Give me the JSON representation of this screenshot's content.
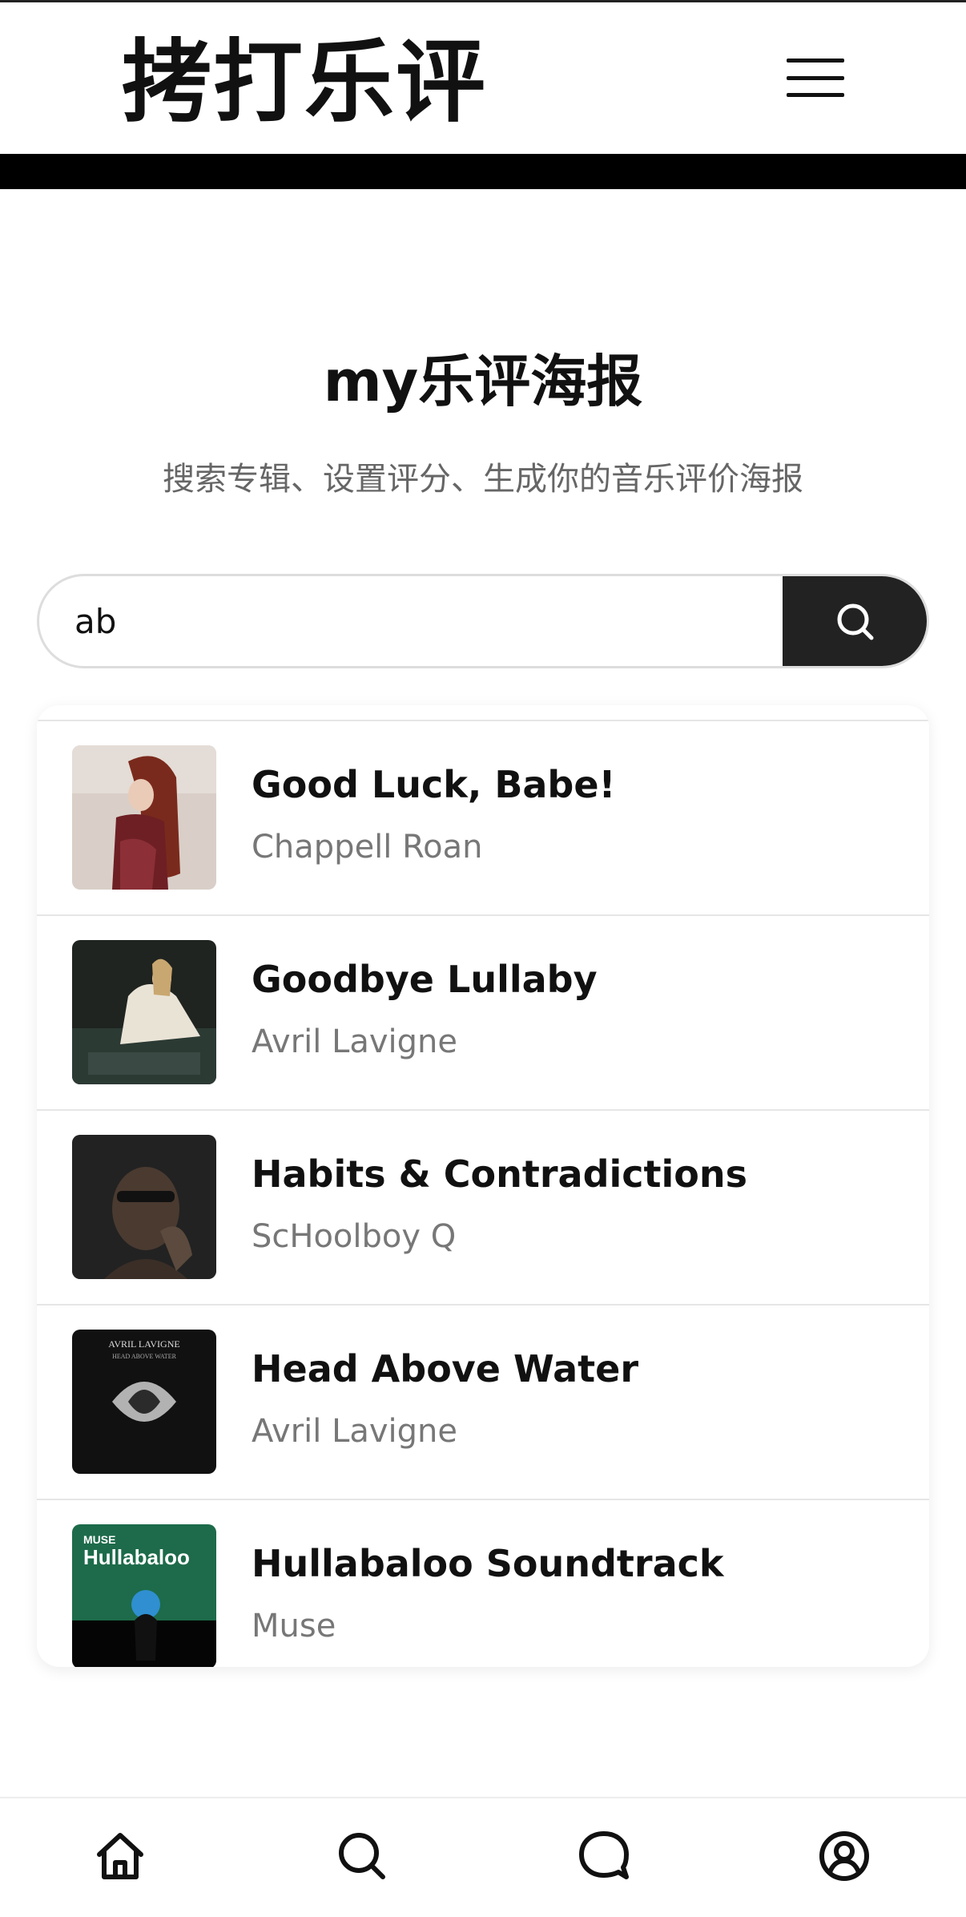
{
  "app": {
    "logo": "拷打乐评"
  },
  "main": {
    "title": "my乐评海报",
    "subtitle": "搜索专辑、设置评分、生成你的音乐评价海报"
  },
  "search": {
    "value": "ab",
    "icon": "search-icon"
  },
  "results": [
    {
      "album": "Good Luck, Babe!",
      "artist": "Chappell Roan"
    },
    {
      "album": "Goodbye Lullaby",
      "artist": "Avril Lavigne"
    },
    {
      "album": "Habits & Contradictions",
      "artist": "ScHoolboy Q"
    },
    {
      "album": "Head Above Water",
      "artist": "Avril Lavigne"
    },
    {
      "album": "Hullabaloo Soundtrack",
      "artist": "Muse"
    }
  ],
  "covers": {
    "c4": {
      "line1": "AVRIL LAVIGNE",
      "line2": "HEAD ABOVE WATER"
    },
    "c5": {
      "line1": "MUSE",
      "line2": "Hullabaloo"
    }
  },
  "nav": [
    {
      "icon": "home-icon"
    },
    {
      "icon": "search-icon"
    },
    {
      "icon": "chat-icon"
    },
    {
      "icon": "user-icon"
    }
  ],
  "colors": {
    "primary": "#222222",
    "muted": "#777777",
    "background": "#ffffff"
  }
}
